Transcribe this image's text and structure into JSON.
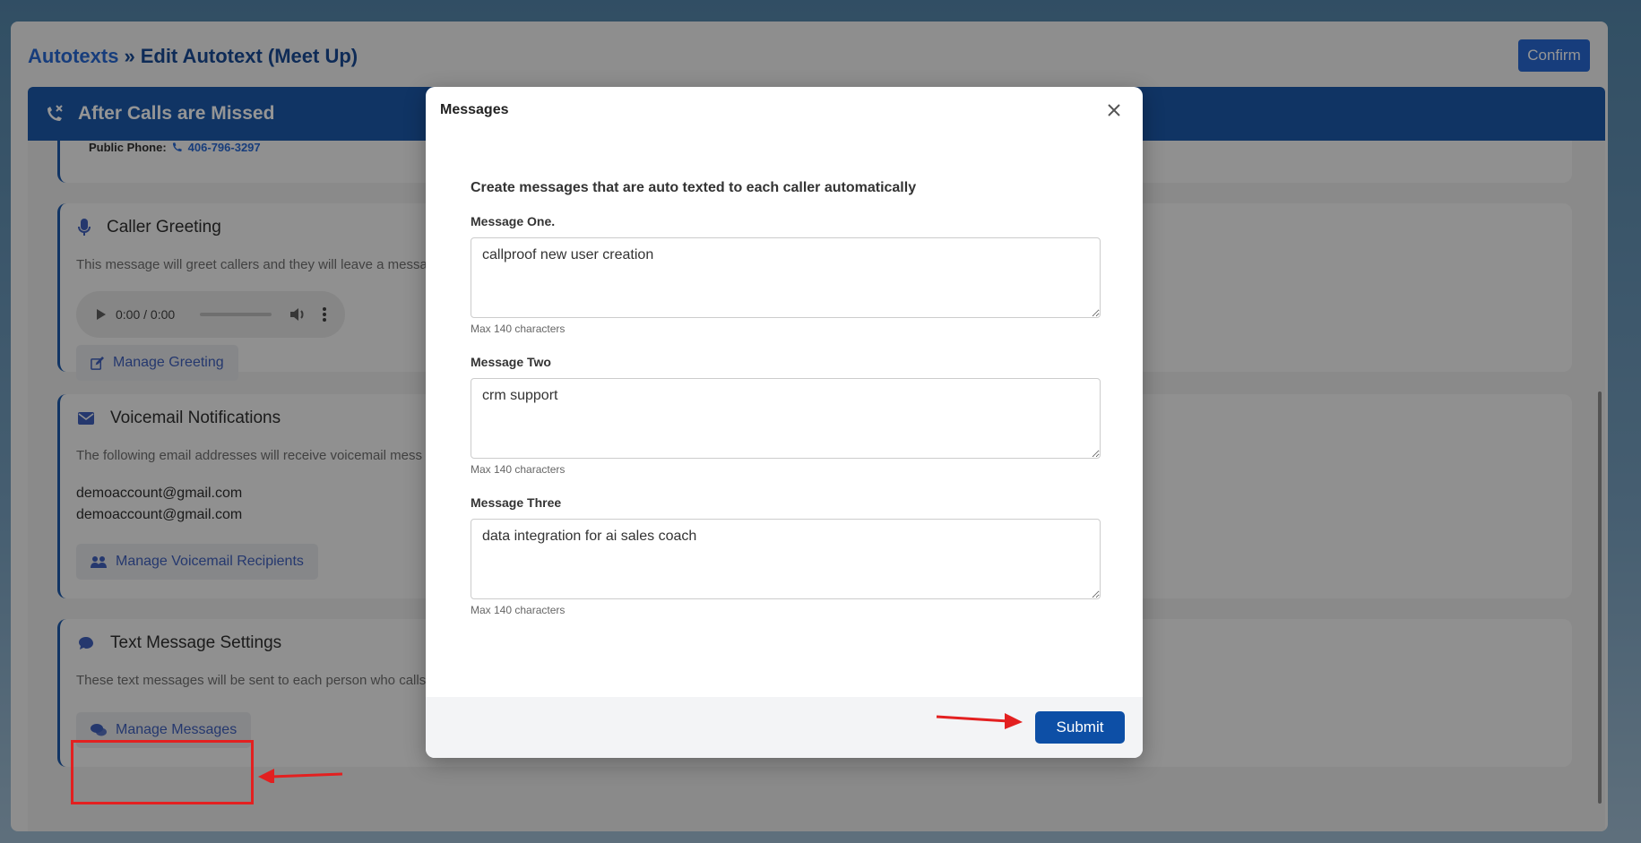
{
  "header": {
    "breadcrumb_link": "Autotexts",
    "breadcrumb_separator": "»",
    "page_title": "Edit Autotext (Meet Up)",
    "confirm_label": "Confirm"
  },
  "banner": {
    "title": "After Calls are Missed"
  },
  "public_phone": {
    "label": "Public Phone:",
    "number": "406-796-3297"
  },
  "caller_greeting": {
    "title": "Caller Greeting",
    "description": "This message will greet callers and they will leave a messa",
    "player_time": "0:00 / 0:00",
    "button_label": "Manage Greeting"
  },
  "voicemail": {
    "title": "Voicemail Notifications",
    "description": "The following email addresses will receive voicemail mess",
    "emails": [
      "demoaccount@gmail.com",
      "demoaccount@gmail.com"
    ],
    "button_label": "Manage Voicemail Recipients"
  },
  "text_messages": {
    "title": "Text Message Settings",
    "description": "These text messages will be sent to each person who calls",
    "button_label": "Manage Messages"
  },
  "modal": {
    "title": "Messages",
    "intro": "Create messages that are auto texted to each caller automatically",
    "fields": [
      {
        "label": "Message One.",
        "value": "callproof new user creation",
        "hint": "Max 140 characters"
      },
      {
        "label": "Message Two",
        "value": "crm support",
        "hint": "Max 140 characters"
      },
      {
        "label": "Message Three",
        "value": "data integration for ai sales coach",
        "hint": "Max 140 characters"
      }
    ],
    "submit_label": "Submit"
  },
  "colors": {
    "brand": "#0d4fa6",
    "link": "#1a5fd1",
    "annotation": "#e32020"
  }
}
